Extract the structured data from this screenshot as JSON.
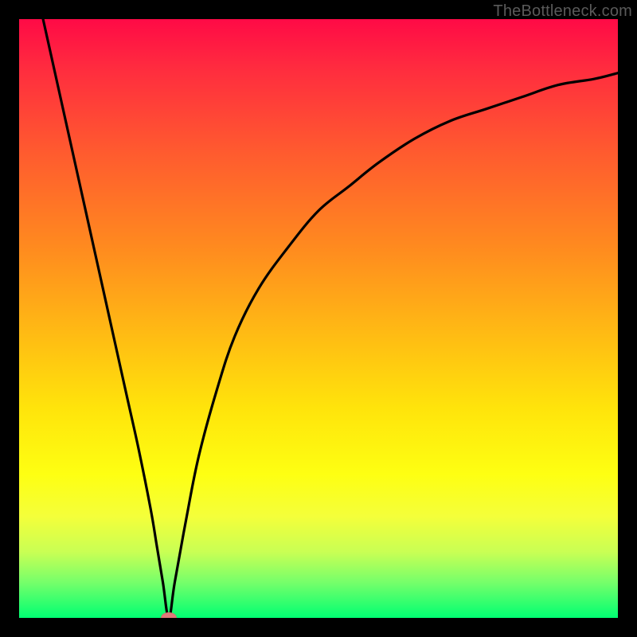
{
  "watermark": {
    "text": "TheBottleneck.com"
  },
  "chart_data": {
    "type": "line",
    "title": "",
    "xlabel": "",
    "ylabel": "",
    "xlim": [
      0,
      100
    ],
    "ylim": [
      0,
      100
    ],
    "grid": false,
    "legend": false,
    "series": [
      {
        "name": "bottleneck-curve",
        "x": [
          4,
          6,
          8,
          10,
          12,
          14,
          16,
          18,
          20,
          22,
          23,
          24,
          25,
          26,
          28,
          30,
          33,
          36,
          40,
          45,
          50,
          55,
          60,
          66,
          72,
          78,
          84,
          90,
          96,
          100
        ],
        "y": [
          100,
          91,
          82,
          73,
          64,
          55,
          46,
          37,
          28,
          18,
          12,
          6,
          0,
          6,
          17,
          27,
          38,
          47,
          55,
          62,
          68,
          72,
          76,
          80,
          83,
          85,
          87,
          89,
          90,
          91
        ]
      }
    ],
    "markers": [
      {
        "name": "minimum-point",
        "x": 25,
        "y": 0
      }
    ],
    "background_gradient": {
      "orientation": "vertical",
      "stops": [
        {
          "pos": 0.0,
          "color": "#ff0a46"
        },
        {
          "pos": 0.38,
          "color": "#ff8a1f"
        },
        {
          "pos": 0.65,
          "color": "#ffe40b"
        },
        {
          "pos": 0.83,
          "color": "#f4ff3a"
        },
        {
          "pos": 1.0,
          "color": "#00ff72"
        }
      ]
    }
  }
}
